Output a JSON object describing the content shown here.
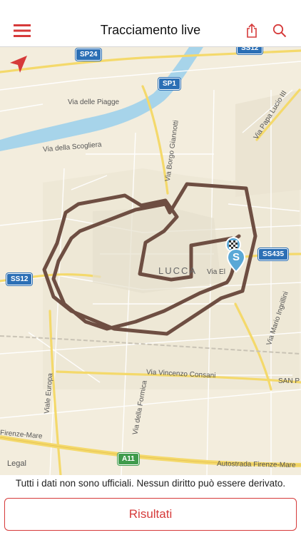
{
  "header": {
    "title": "Tracciamento live",
    "menu_icon": "hamburger-menu-icon",
    "share_icon": "share-icon",
    "search_icon": "search-icon"
  },
  "map": {
    "legal": "Legal",
    "city": "LUCCA",
    "shields": {
      "sp24": "SP24",
      "sp1": "SP1",
      "ss435": "SS435",
      "ss12": "SS12",
      "a11": "A11",
      "top_right": "SS12"
    },
    "labels": {
      "via_delle_piagge": "Via delle Piagge",
      "via_della_scogliera": "Via della Scogliera",
      "via_borgo_giannotti": "Via Borgo Giannotti",
      "via_papa_lucio": "Via Papa Lucio III",
      "via_vincenzo_consani": "Via Vincenzo Consani",
      "viale_europa": "Viale Europa",
      "via_della_formica": "Via della Formica",
      "via_mario_ingrillini": "Via Mario Ingrillini",
      "autostrada": "Autostrada Firenze-Mare",
      "firenze_mare": "Firenze-Mare",
      "via_el": "Via El",
      "san_p": "SAN P"
    },
    "markers": {
      "start": "S",
      "finish_icon": "checkered-flag-icon",
      "location_icon": "location-arrow-icon"
    },
    "colors": {
      "track": "#6e4e42",
      "water": "#a7d4ea",
      "accent": "#d63a3a"
    }
  },
  "footer": {
    "disclaimer": "Tutti i dati non sono ufficiali. Nessun diritto può essere derivato.",
    "results_label": "Risultati"
  }
}
